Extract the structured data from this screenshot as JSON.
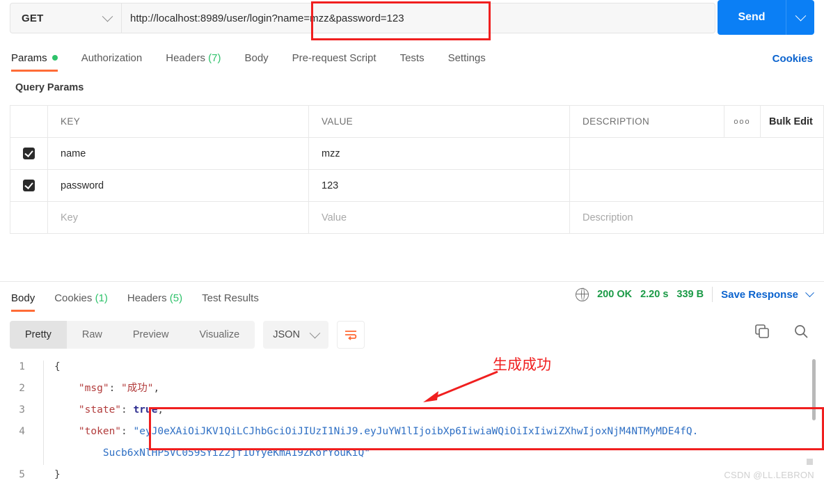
{
  "request": {
    "method": "GET",
    "url": "http://localhost:8989/user/login?name=mzz&password=123",
    "send_label": "Send",
    "tabs": [
      {
        "label": "Params",
        "badge": "dot",
        "active": true
      },
      {
        "label": "Authorization",
        "badge": "",
        "active": false
      },
      {
        "label": "Headers",
        "badge": "(7)",
        "active": false
      },
      {
        "label": "Body",
        "badge": "",
        "active": false
      },
      {
        "label": "Pre-request Script",
        "badge": "",
        "active": false
      },
      {
        "label": "Tests",
        "badge": "",
        "active": false
      },
      {
        "label": "Settings",
        "badge": "",
        "active": false
      }
    ],
    "cookies_link": "Cookies"
  },
  "query_params": {
    "section_title": "Query Params",
    "columns": [
      "KEY",
      "VALUE",
      "DESCRIPTION"
    ],
    "bulk_edit_label": "Bulk Edit",
    "options_icon": "ooo",
    "rows": [
      {
        "checked": true,
        "key": "name",
        "value": "mzz",
        "description": ""
      },
      {
        "checked": true,
        "key": "password",
        "value": "123",
        "description": ""
      }
    ],
    "placeholder_row": {
      "key": "Key",
      "value": "Value",
      "description": "Description"
    }
  },
  "response": {
    "tabs": [
      {
        "label": "Body",
        "badge": "",
        "active": true
      },
      {
        "label": "Cookies",
        "badge": "(1)",
        "active": false
      },
      {
        "label": "Headers",
        "badge": "(5)",
        "active": false
      },
      {
        "label": "Test Results",
        "badge": "",
        "active": false
      }
    ],
    "status": "200 OK",
    "time": "2.20 s",
    "size": "339 B",
    "save_response_label": "Save Response",
    "view_modes": [
      "Pretty",
      "Raw",
      "Preview",
      "Visualize"
    ],
    "active_view": "Pretty",
    "format": "JSON",
    "icons": {
      "globe": "globe-icon",
      "wrap": "wrap-lines-icon",
      "copy": "copy-icon",
      "search": "search-icon"
    }
  },
  "code": {
    "line_numbers": [
      "1",
      "2",
      "3",
      "4",
      "5"
    ],
    "lines": [
      "{",
      "    \"msg\": \"成功\",",
      "    \"state\": true,",
      "    \"token\": \"eyJ0eXAiOiJKV1QiLCJhbGciOiJIUzI1NiJ9.eyJuYW1lIjoibXp6IiwiaWQiOiIxIiwiZXhwIjoxNjM4NTMyMDE4fQ.",
      "        Sucb6xNlHP5VC059SYiZ2jf1UYyeKmA19ZKorYouKiQ\"",
      "}"
    ],
    "parts": {
      "l1_brace": "{",
      "l2_key": "\"msg\"",
      "l2_val": "\"成功\"",
      "l3_key": "\"state\"",
      "l3_val": "true",
      "l4_key": "\"token\"",
      "l4_val_a": "\"eyJ0eXAiOiJKV1QiLCJhbGciOiJIUzI1NiJ9.eyJuYW1lIjoibXp6IiwiaWQiOiIxIiwiZXhwIjoxNjM4NTMyMDE4fQ.",
      "l4_val_b": "Sucb6xNlHP5VC059SYiZ2jf1UYyeKmA19ZKorYouKiQ\"",
      "l5_brace": "}"
    }
  },
  "annotation": {
    "text": "生成成功",
    "color": "#f01f1f"
  },
  "watermark": "CSDN @LL.LEBRON",
  "colors": {
    "accent_orange": "#ff6c37",
    "link_blue": "#0b63ce",
    "send_blue": "#0b7ff5",
    "status_green": "#1a9a46",
    "highlight_red": "#f01f1f"
  }
}
